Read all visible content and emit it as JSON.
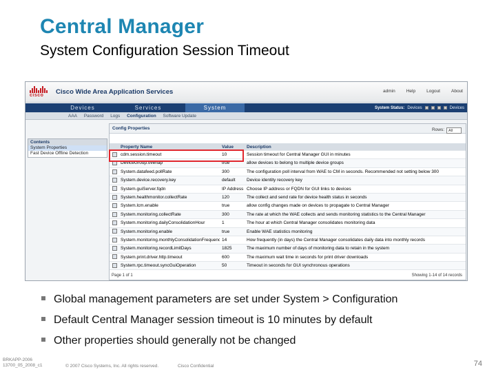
{
  "slide": {
    "title": "Central Manager",
    "subtitle": "System Configuration Session Timeout"
  },
  "screenshot": {
    "header": {
      "logo_word": "cisco",
      "app_name": "Cisco Wide Area Application Services",
      "links": [
        "admin",
        "Help",
        "Logout",
        "About"
      ]
    },
    "nav": {
      "tabs": [
        "Devices",
        "Services",
        "System"
      ],
      "active_tab": "System",
      "status_label": "System Status:",
      "status_value": "Devices",
      "status_extra": "Devices"
    },
    "subnav": [
      "AAA",
      "Password",
      "Logs",
      "Configuration",
      "Software Update"
    ],
    "subnav_current": "Configuration",
    "sidebar": {
      "title": "Contents",
      "items": [
        "System Properties",
        "Fast Device Offline Detection"
      ]
    },
    "content": {
      "title": "Config Properties",
      "rows_label": "Rows:",
      "rows_value": "All",
      "columns": [
        "Property Name",
        "Value",
        "Description"
      ],
      "rows": [
        {
          "name": "cdm.session.timeout",
          "value": "10",
          "desc": "Session timeout for Central Manager GUI in minutes"
        },
        {
          "name": "DeviceGroup.overlap",
          "value": "true",
          "desc": "allow devices to belong to multiple device groups"
        },
        {
          "name": "System.datafeed.pollRate",
          "value": "300",
          "desc": "The configuration poll interval from WAE to CM in seconds. Recommended not setting below 300"
        },
        {
          "name": "System.device.recovery.key",
          "value": "default",
          "desc": "Device identity recovery key"
        },
        {
          "name": "System.guiServer.fqdn",
          "value": "IP Address",
          "desc": "Choose IP address or FQDN for GUI links to devices"
        },
        {
          "name": "System.healthmonitor.collectRate",
          "value": "120",
          "desc": "The collect and send rate for device health status in seconds"
        },
        {
          "name": "System.lcm.enable",
          "value": "true",
          "desc": "allow config changes made on devices to propagate to Central Manager"
        },
        {
          "name": "System.monitoring.collectRate",
          "value": "300",
          "desc": "The rate at which the WAE collects and sends monitoring statistics to the Central Manager"
        },
        {
          "name": "System.monitoring.dailyConsolidationHour",
          "value": "1",
          "desc": "The hour at which Central Manager consolidates monitoring data"
        },
        {
          "name": "System.monitoring.enable",
          "value": "true",
          "desc": "Enable WAE statistics monitoring"
        },
        {
          "name": "System.monitoring.monthlyConsolidationFrequency",
          "value": "14",
          "desc": "How frequently (in days) the Central Manager consolidates daily data into monthly records"
        },
        {
          "name": "System.monitoring.recordLimitDays",
          "value": "1825",
          "desc": "The maximum number of days of monitoring data to retain in the system"
        },
        {
          "name": "System.print.driver.http.timeout",
          "value": "600",
          "desc": "The maximum wait time in seconds for print driver downloads"
        },
        {
          "name": "System.rpc.timeout.syncGuiOperation",
          "value": "50",
          "desc": "Timeout in seconds for GUI synchronous operations"
        }
      ],
      "pager_left": "Page 1 of 1",
      "pager_right": "Showing 1-14 of 14 records"
    }
  },
  "bullets": [
    "Global management parameters are set under System > Configuration",
    "Default Central Manager session timeout is 10 minutes by default",
    "Other properties should generally not be changed"
  ],
  "footer": {
    "session_line1": "BRKAPP-2006",
    "session_line2": "13700_05_2008_c1",
    "copyright": "© 2007 Cisco Systems, Inc. All rights reserved.",
    "confidential": "Cisco Confidential",
    "page_number": "74"
  },
  "colors": {
    "title": "#1e86b2",
    "nav_bar": "#1b3f72",
    "highlight_box": "#e0262d",
    "cisco_red": "#c61c22"
  }
}
